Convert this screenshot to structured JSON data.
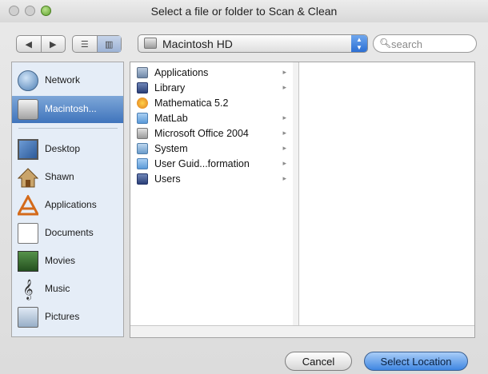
{
  "window": {
    "title": "Select a file or folder to Scan & Clean"
  },
  "toolbar": {
    "back_label": "◀",
    "forward_label": "▶",
    "list_view_label": "☰",
    "column_view_label": "▥",
    "location": "Macintosh HD",
    "popup_arrows": "▲▼",
    "search_placeholder": "search",
    "search_value": ""
  },
  "sidebar": {
    "devices": [
      {
        "label": "Network",
        "icon": "network-globe-icon",
        "selected": false
      },
      {
        "label": "Macintosh...",
        "icon": "hard-disk-icon",
        "selected": true
      }
    ],
    "places": [
      {
        "label": "Desktop",
        "icon": "desktop-icon"
      },
      {
        "label": "Shawn",
        "icon": "home-icon"
      },
      {
        "label": "Applications",
        "icon": "applications-icon"
      },
      {
        "label": "Documents",
        "icon": "documents-icon"
      },
      {
        "label": "Movies",
        "icon": "movies-icon"
      },
      {
        "label": "Music",
        "icon": "music-icon"
      },
      {
        "label": "Pictures",
        "icon": "pictures-icon"
      }
    ]
  },
  "browser": {
    "column1": [
      {
        "label": "Applications",
        "icon": "applications-folder-icon",
        "has_children": true
      },
      {
        "label": "Library",
        "icon": "library-folder-icon",
        "has_children": true
      },
      {
        "label": "Mathematica 5.2",
        "icon": "mathematica-icon",
        "has_children": false
      },
      {
        "label": "MatLab",
        "icon": "folder-icon",
        "has_children": true
      },
      {
        "label": "Microsoft Office 2004",
        "icon": "office-folder-icon",
        "has_children": true
      },
      {
        "label": "System",
        "icon": "system-folder-icon",
        "has_children": true
      },
      {
        "label": "User Guid...formation",
        "icon": "folder-icon",
        "has_children": true
      },
      {
        "label": "Users",
        "icon": "users-folder-icon",
        "has_children": true
      }
    ],
    "arrow_glyph": "▸"
  },
  "buttons": {
    "cancel": "Cancel",
    "select": "Select Location"
  },
  "colors": {
    "selection": "#3f74bc",
    "primary_button": "#3f86e2",
    "sidebar_bg": "#e5edf7"
  }
}
